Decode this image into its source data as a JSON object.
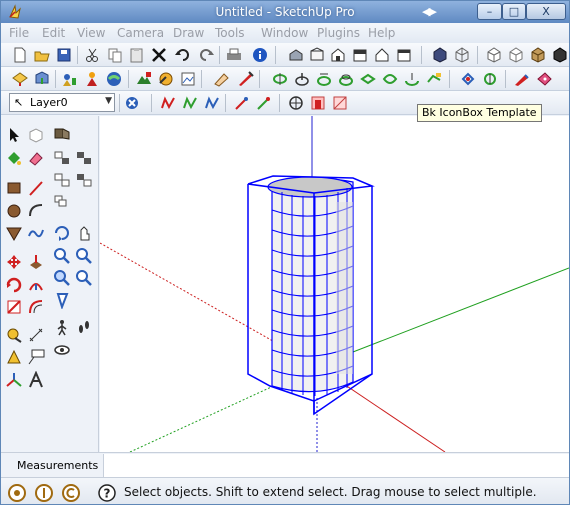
{
  "window": {
    "title": "Untitled - SketchUp Pro",
    "nav_arrows": "◀▶",
    "min_glyph": "–",
    "max_glyph": "□",
    "close_glyph": "X"
  },
  "menu": {
    "items": [
      "File",
      "Edit",
      "View",
      "Camera",
      "Draw",
      "Tools",
      "Window",
      "Plugins",
      "Help"
    ]
  },
  "layer": {
    "selected": "Layer0",
    "arrow_glyph": "↖",
    "dropdown_glyph": "▼"
  },
  "tooltip": {
    "text": "Bk IconBox Template"
  },
  "measurements": {
    "label": "Measurements",
    "value": ""
  },
  "status": {
    "text": "Select objects. Shift to extend select. Drag mouse to select multiple.",
    "help_glyph": "?"
  },
  "colors": {
    "title_bar": "#6f97cc",
    "axis_blue": "#2020d0",
    "axis_red": "#cc2020",
    "axis_green": "#20a020",
    "selection_box": "#0000ff",
    "sky_background": "#ffffff",
    "cylinder_face": "#eeeeee"
  },
  "icons": {
    "toolbar_row1": [
      "new-icon",
      "open-icon",
      "save-icon",
      "cut-icon",
      "copy-icon",
      "paste-icon",
      "erase-icon",
      "undo-icon",
      "redo-icon",
      "print-icon",
      "model-info-icon",
      "iso-view-icon",
      "top-view-icon",
      "front-view-icon",
      "right-view-icon",
      "back-view-icon",
      "left-view-icon",
      "xray-icon",
      "wireframe-icon",
      "hidden-line-icon",
      "shaded-icon",
      "shaded-textures-icon",
      "monochrome-icon"
    ],
    "toolbar_row2": [
      "get-models-icon",
      "share-model-icon",
      "share-component-icon",
      "get-photo-texture-icon",
      "add-location-icon",
      "toggle-terrain-icon",
      "preview-earth-icon",
      "photo-textures-icon",
      "section-plane-icon",
      "text-tag-icon",
      "follow-me-icon",
      "push-pull-icon",
      "intersect-icon",
      "outer-shell-icon",
      "union-icon",
      "subtract-icon",
      "trim-icon",
      "split-icon",
      "previous-view-icon",
      "next-view-icon",
      "pencil-erase-icon",
      "red-tag-icon"
    ],
    "toolbar_row3": [
      "layer-manager-icon",
      "sandbox-contours-icon",
      "sandbox-scratch-icon",
      "sandbox-smoove-icon",
      "sandbox-stamp-icon",
      "sandbox-drape-icon",
      "sandbox-detail-icon",
      "section-display-icon",
      "section-plane-icon",
      "section-cuts-icon"
    ]
  }
}
